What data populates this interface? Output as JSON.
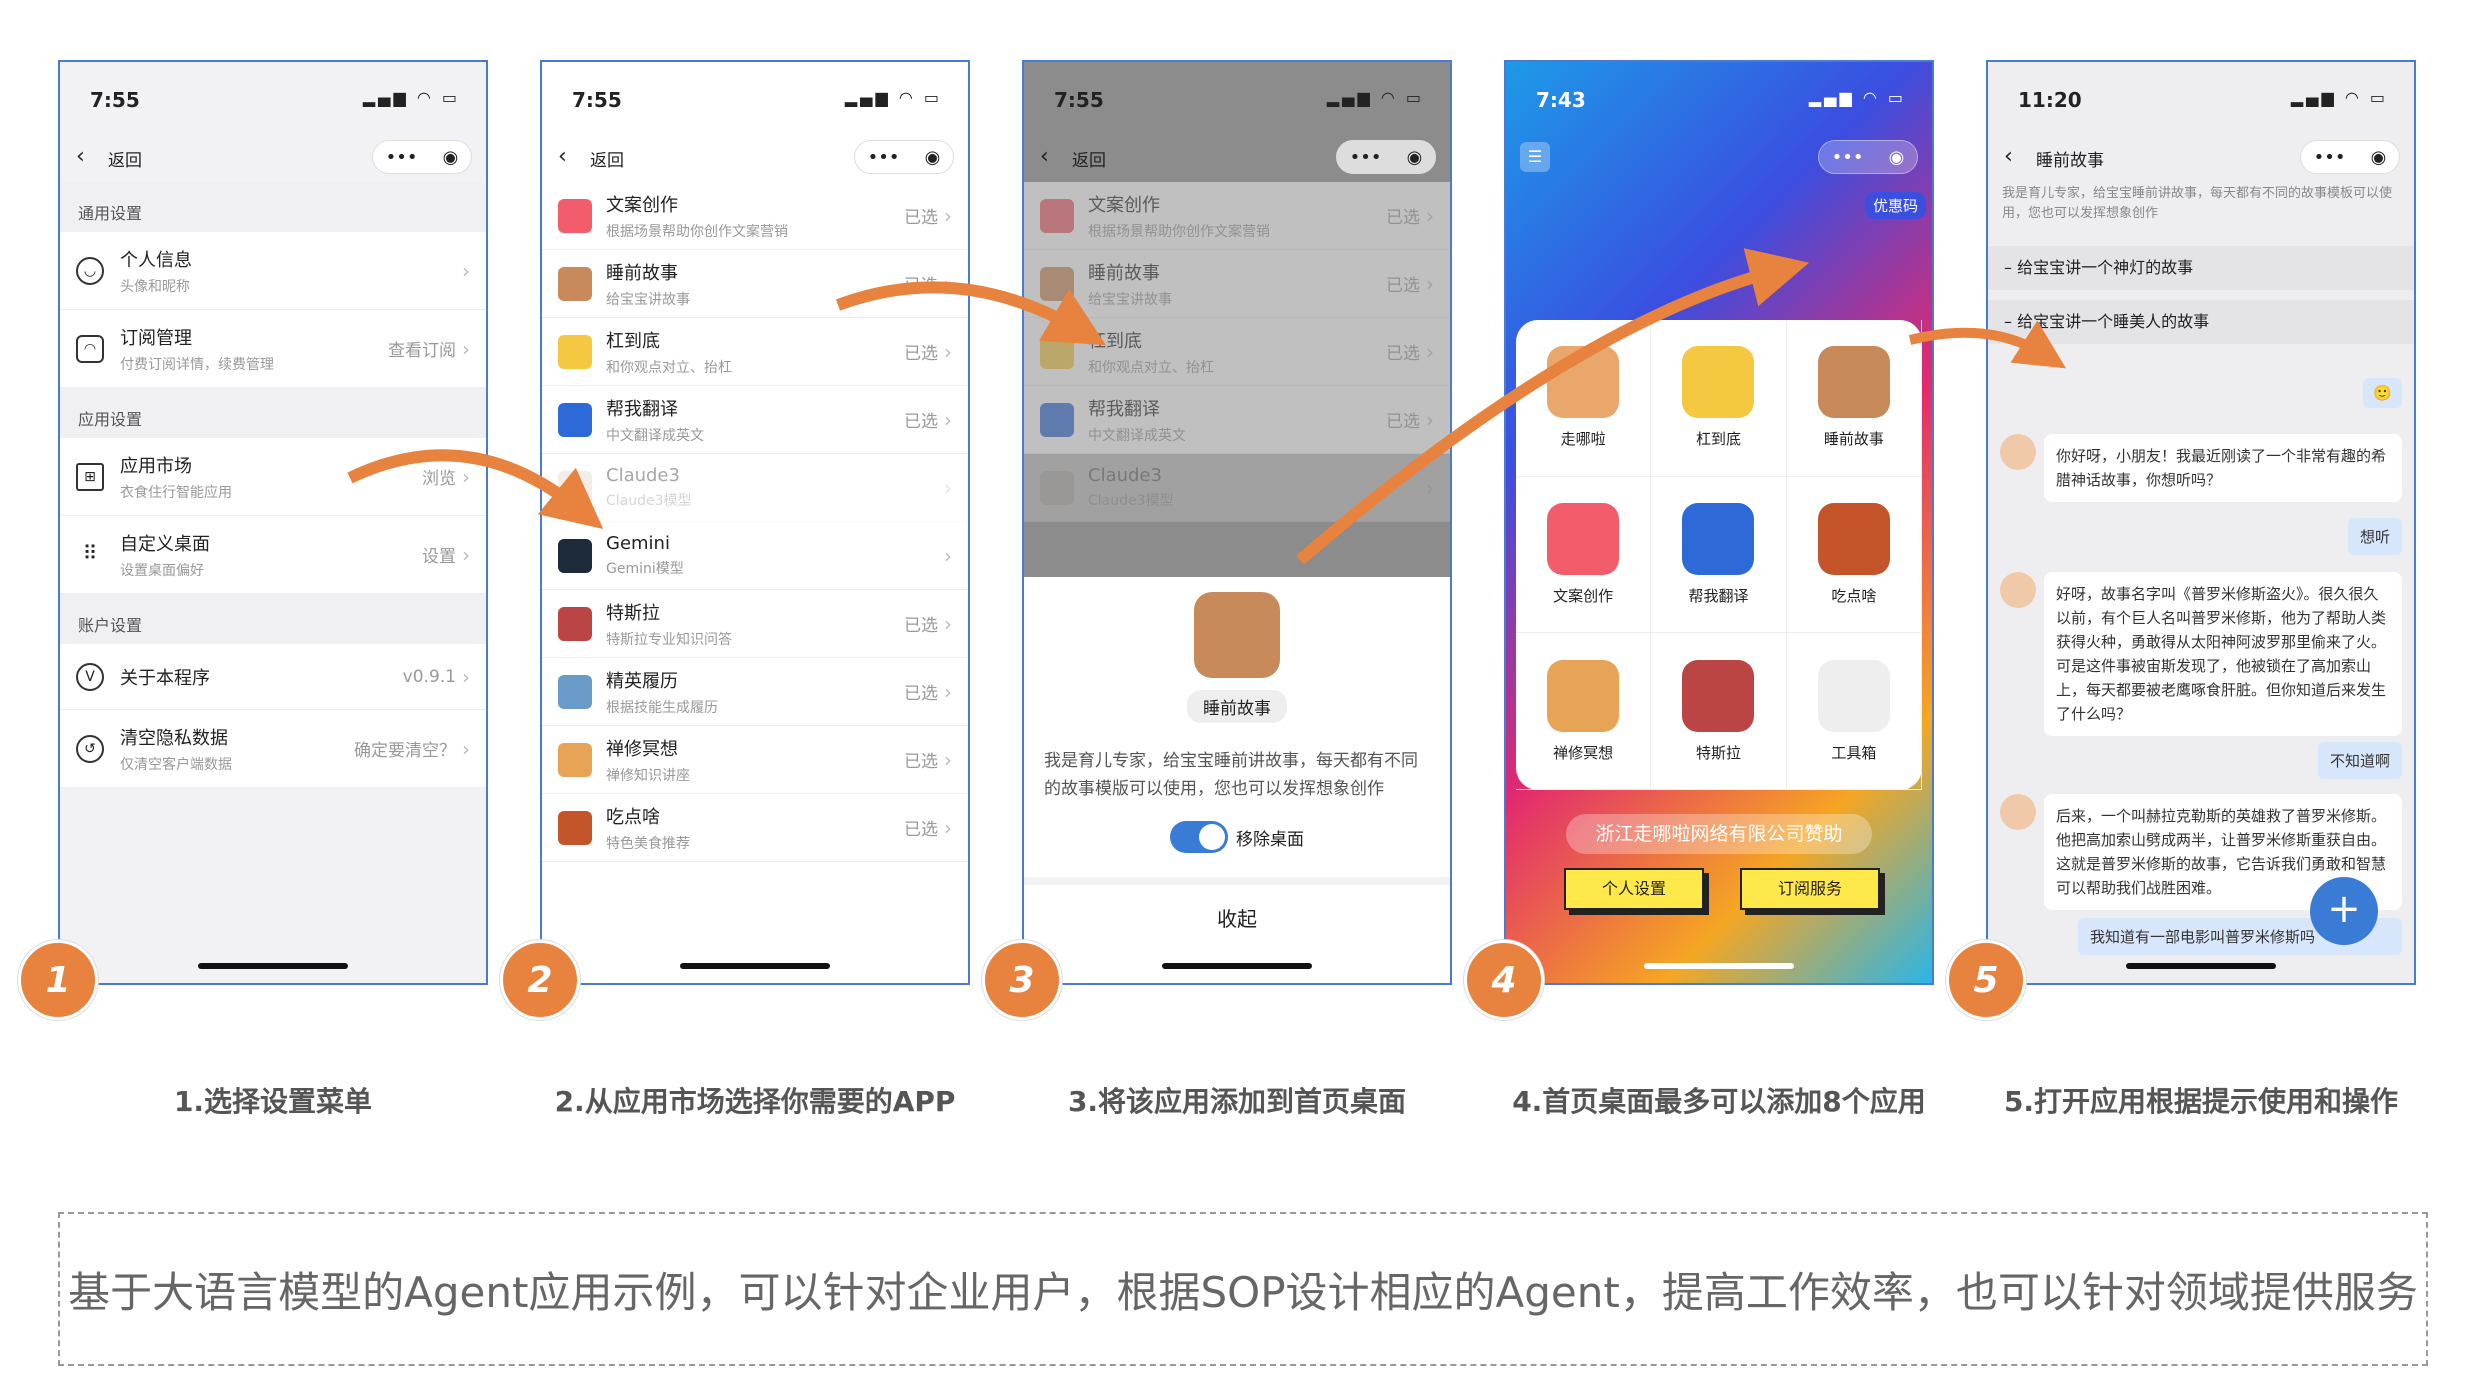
{
  "p1": {
    "time": "7:55",
    "back": "返回",
    "sec1": "通用设置",
    "sec2": "应用设置",
    "sec3": "账户设置",
    "rows": [
      {
        "t": "个人信息",
        "s": "头像和昵称",
        "v": ""
      },
      {
        "t": "订阅管理",
        "s": "付费订阅详情，续费管理",
        "v": "查看订阅"
      },
      {
        "t": "应用市场",
        "s": "衣食住行智能应用",
        "v": "浏览"
      },
      {
        "t": "自定义桌面",
        "s": "设置桌面偏好",
        "v": "设置"
      },
      {
        "t": "关于本程序",
        "s": "",
        "v": "v0.9.1"
      },
      {
        "t": "清空隐私数据",
        "s": "仅清空客户端数据",
        "v": "确定要清空？"
      }
    ]
  },
  "p2": {
    "time": "7:55",
    "back": "返回",
    "apps": [
      {
        "t": "文案创作",
        "s": "根据场景帮助你创作文案营销",
        "v": "已选",
        "c": "#f35d6b"
      },
      {
        "t": "睡前故事",
        "s": "给宝宝讲故事",
        "v": "已选",
        "c": "#c88a5a"
      },
      {
        "t": "杠到底",
        "s": "和你观点对立、抬杠",
        "v": "已选",
        "c": "#f5c842"
      },
      {
        "t": "帮我翻译",
        "s": "中文翻译成英文",
        "v": "已选",
        "c": "#2d6ad8"
      },
      {
        "t": "Claude3",
        "s": "Claude3模型",
        "v": "",
        "c": "#ddd3c4"
      },
      {
        "t": "Gemini",
        "s": "Gemini模型",
        "v": "",
        "c": "#1c2a3a"
      },
      {
        "t": "特斯拉",
        "s": "特斯拉专业知识问答",
        "v": "已选",
        "c": "#b44"
      },
      {
        "t": "精英履历",
        "s": "根据技能生成履历",
        "v": "已选",
        "c": "#6a9ac8"
      },
      {
        "t": "禅修冥想",
        "s": "禅修知识讲座",
        "v": "已选",
        "c": "#e8a456"
      },
      {
        "t": "吃点啥",
        "s": "特色美食推荐",
        "v": "已选",
        "c": "#c4552b"
      }
    ]
  },
  "p3": {
    "time": "7:55",
    "back": "返回",
    "name": "睡前故事",
    "desc": "我是育儿专家，给宝宝睡前讲故事，每天都有不同的故事模版可以使用，您也可以发挥想象创作",
    "toggle": "移除桌面",
    "close": "收起"
  },
  "p4": {
    "time": "7:43",
    "coupon": "优惠码",
    "apps": [
      {
        "t": "走哪啦",
        "c": "#e9a76b"
      },
      {
        "t": "杠到底",
        "c": "#f5c842"
      },
      {
        "t": "睡前故事",
        "c": "#c88a5a"
      },
      {
        "t": "文案创作",
        "c": "#f35d6b"
      },
      {
        "t": "帮我翻译",
        "c": "#2d6ad8"
      },
      {
        "t": "吃点啥",
        "c": "#c4552b"
      },
      {
        "t": "禅修冥想",
        "c": "#e8a456"
      },
      {
        "t": "特斯拉",
        "c": "#b44"
      },
      {
        "t": "工具箱",
        "c": "#eeeeee"
      }
    ],
    "sponsor": "浙江走哪啦网络有限公司赞助",
    "btn1": "个人设置",
    "btn2": "订阅服务"
  },
  "p5": {
    "time": "11:20",
    "title": "睡前故事",
    "intro": "我是育儿专家，给宝宝睡前讲故事，每天都有不同的故事模板可以使用，您也可以发挥想象创作",
    "prompt1": "– 给宝宝讲一个神灯的故事",
    "prompt2": "– 给宝宝讲一个睡美人的故事",
    "emoji": "🙂",
    "m1": "你好呀，小朋友！我最近刚读了一个非常有趣的希腊神话故事，你想听吗？",
    "u1": "想听",
    "m2": "好呀，故事名字叫《普罗米修斯盗火》。很久很久以前，有个巨人名叫普罗米修斯，他为了帮助人类获得火种，勇敢得从太阳神阿波罗那里偷来了火。可是这件事被宙斯发现了，他被锁在了高加索山上，每天都要被老鹰啄食肝脏。但你知道后来发生了什么吗？",
    "u2": "不知道啊",
    "m3": "后来，一个叫赫拉克勒斯的英雄救了普罗米修斯。他把高加索山劈成两半，让普罗米修斯重获自由。这就是普罗米修斯的故事，它告诉我们勇敢和智慧可以帮助我们战胜困难。",
    "u3": "我知道有一部电影叫普罗米修斯吗"
  },
  "captions": [
    "1.选择设置菜单",
    "2.从应用市场选择你需要的APP",
    "3.将该应用添加到首页桌面",
    "4.首页桌面最多可以添加8个应用",
    "5.打开应用根据提示使用和操作"
  ],
  "badges": [
    "1",
    "2",
    "3",
    "4",
    "5"
  ],
  "footer": "基于大语言模型的Agent应用示例，可以针对企业用户，根据SOP设计相应的Agent，提高工作效率，也可以针对领域提供服务",
  "colors": {
    "accent": "#e8823f",
    "border": "#4a7bd0"
  }
}
